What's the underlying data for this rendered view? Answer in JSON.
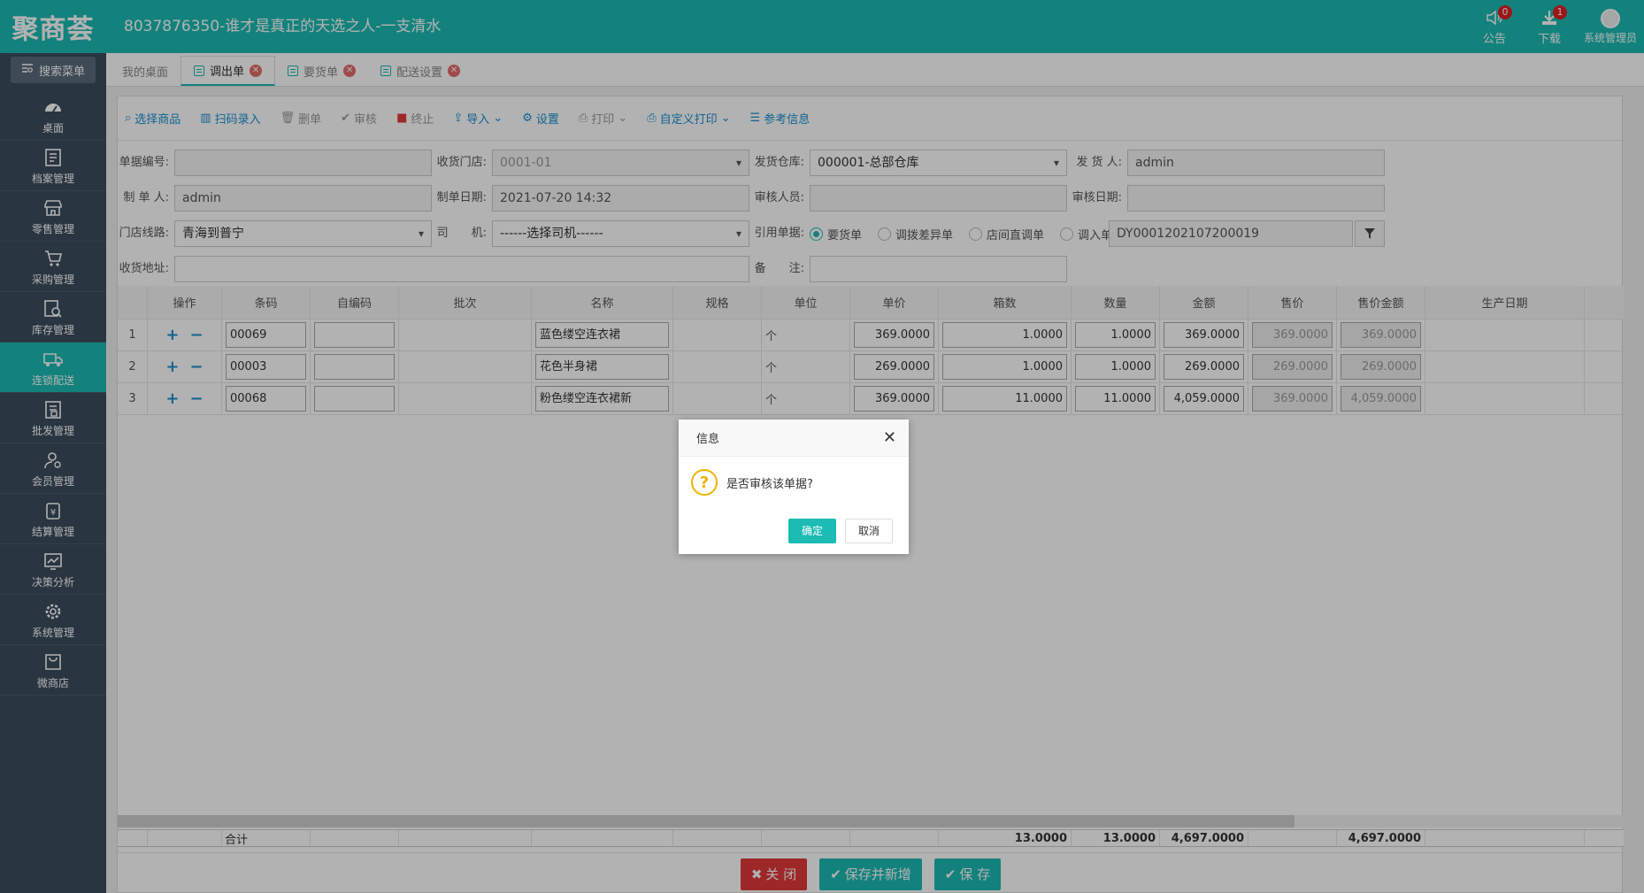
{
  "header": {
    "logo": "聚商荟",
    "title": "8037876350-谁才是真正的天选之人-一支清水",
    "announce_label": "公告",
    "announce_count": "0",
    "download_label": "下载",
    "download_count": "1",
    "user_label": "系统管理员"
  },
  "sidebar": {
    "search_label": "搜索菜单",
    "items": [
      {
        "label": "桌面",
        "icon": "dashboard-icon"
      },
      {
        "label": "档案管理",
        "icon": "archive-icon"
      },
      {
        "label": "零售管理",
        "icon": "store-icon"
      },
      {
        "label": "采购管理",
        "icon": "cart-icon"
      },
      {
        "label": "库存管理",
        "icon": "inventory-icon"
      },
      {
        "label": "连锁配送",
        "icon": "truck-icon"
      },
      {
        "label": "批发管理",
        "icon": "wholesale-icon"
      },
      {
        "label": "会员管理",
        "icon": "member-icon"
      },
      {
        "label": "结算管理",
        "icon": "settlement-icon"
      },
      {
        "label": "决策分析",
        "icon": "chart-icon"
      },
      {
        "label": "系统管理",
        "icon": "gear-icon"
      },
      {
        "label": "微商店",
        "icon": "shop-bag-icon"
      }
    ]
  },
  "tabs": [
    "我的桌面",
    "调出单",
    "要货单",
    "配送设置"
  ],
  "toolbar": {
    "select_goods": "选择商品",
    "scan_entry": "扫码录入",
    "delete": "删单",
    "audit": "审核",
    "terminate": "终止",
    "import": "导入",
    "settings": "设置",
    "print": "打印",
    "custom_print": "自定义打印",
    "reference": "参考信息"
  },
  "form": {
    "doc_no_label": "单据编号:",
    "doc_no": "",
    "recv_store_label": "收货门店:",
    "recv_store": "0001-01",
    "ship_wh_label": "发货仓库:",
    "ship_wh": "000001-总部仓库",
    "shipper_label": "发 货 人:",
    "shipper": "admin",
    "maker_label": "制 单 人:",
    "maker": "admin",
    "make_date_label": "制单日期:",
    "make_date": "2021-07-20 14:32",
    "auditor_label": "审核人员:",
    "auditor": "",
    "audit_date_label": "审核日期:",
    "audit_date": "",
    "route_label": "门店线路:",
    "route": "青海到普宁",
    "driver_label": "司　　机:",
    "driver": "------选择司机------",
    "ref_label": "引用单据:",
    "ref_options": [
      "要货单",
      "调拨差异单",
      "店间直调单",
      "调入单"
    ],
    "ref_no": "DY0001202107200019",
    "address_label": "收货地址:",
    "address": "",
    "remark_label": "备　　注:",
    "remark": ""
  },
  "grid": {
    "columns": [
      "",
      "操作",
      "条码",
      "自编码",
      "批次",
      "名称",
      "规格",
      "单位",
      "单价",
      "箱数",
      "数量",
      "金额",
      "售价",
      "售价金额",
      "生产日期"
    ],
    "rows": [
      {
        "no": "1",
        "barcode": "00069",
        "selfcode": "",
        "batch": "",
        "name": "蓝色缕空连衣裙",
        "spec": "",
        "unit": "个",
        "price": "369.0000",
        "boxes": "1.0000",
        "qty": "1.0000",
        "amount": "369.0000",
        "sale_price": "369.0000",
        "sale_amount": "369.0000",
        "prod_date": ""
      },
      {
        "no": "2",
        "barcode": "00003",
        "selfcode": "",
        "batch": "",
        "name": "花色半身裙",
        "spec": "",
        "unit": "个",
        "price": "269.0000",
        "boxes": "1.0000",
        "qty": "1.0000",
        "amount": "269.0000",
        "sale_price": "269.0000",
        "sale_amount": "269.0000",
        "prod_date": ""
      },
      {
        "no": "3",
        "barcode": "00068",
        "selfcode": "",
        "batch": "",
        "name": "粉色缕空连衣裙新",
        "spec": "",
        "unit": "个",
        "price": "369.0000",
        "boxes": "11.0000",
        "qty": "11.0000",
        "amount": "4,059.0000",
        "sale_price": "369.0000",
        "sale_amount": "4,059.0000",
        "prod_date": ""
      }
    ],
    "total_label": "合计",
    "total_boxes": "13.0000",
    "total_qty": "13.0000",
    "total_amount": "4,697.0000",
    "total_sale_amount": "4,697.0000"
  },
  "actions": {
    "close": "关 闭",
    "save_new": "保存并新增",
    "save": "保 存"
  },
  "dialog": {
    "title": "信息",
    "message": "是否审核该单据?",
    "ok": "确定",
    "cancel": "取消"
  },
  "colors": {
    "accent": "#1cbbb4",
    "sidebar": "#3c4d5c",
    "danger": "#e3383a"
  }
}
